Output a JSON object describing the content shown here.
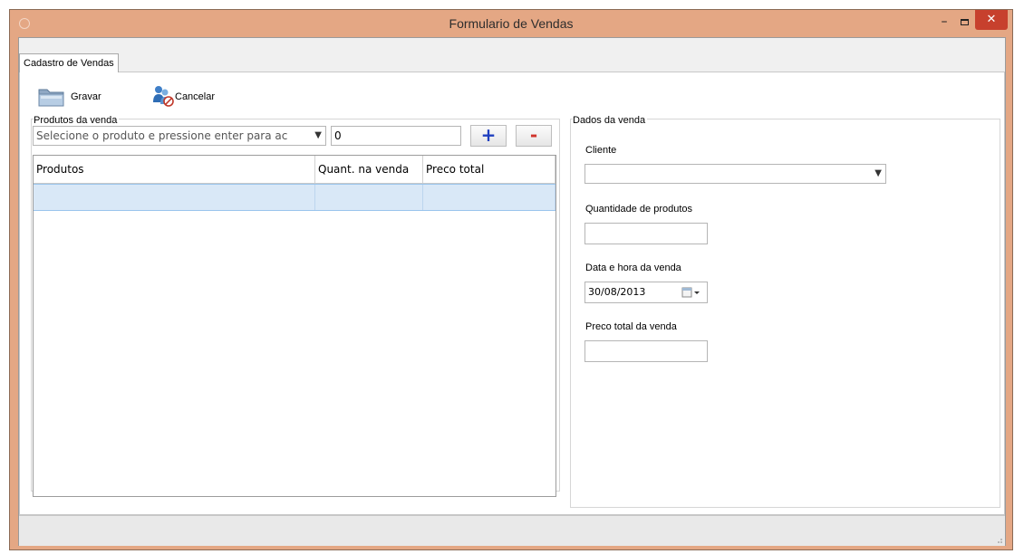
{
  "window": {
    "title": "Formulario de Vendas",
    "min_glyph": "–",
    "close_glyph": "✕"
  },
  "tabs": [
    {
      "label": "Cadastro de Vendas",
      "active": true
    }
  ],
  "toolbar": {
    "save_label": "Gravar",
    "cancel_label": "Cancelar"
  },
  "produtos": {
    "group_label": "Produtos da venda",
    "product_combo_placeholder": "Selecione o produto e pressione enter para ac",
    "quantity_value": "0",
    "add_glyph": "+",
    "remove_glyph": "-",
    "columns": [
      "Produtos",
      "Quant. na venda",
      "Preco total"
    ],
    "rows": [
      [
        "",
        "",
        ""
      ]
    ]
  },
  "dados": {
    "group_label": "Dados da venda",
    "cliente_label": "Cliente",
    "cliente_value": "",
    "quantidade_label": "Quantidade de produtos",
    "quantidade_value": "",
    "data_label": "Data e hora da venda",
    "data_value": "30/08/2013",
    "preco_label": "Preco total da venda",
    "preco_value": ""
  },
  "colors": {
    "title_bar": "#e4a784",
    "close_button": "#c7402d",
    "add_button": "#1f3fbf",
    "remove_button": "#d0342c",
    "selected_row": "#d9e8f7"
  }
}
